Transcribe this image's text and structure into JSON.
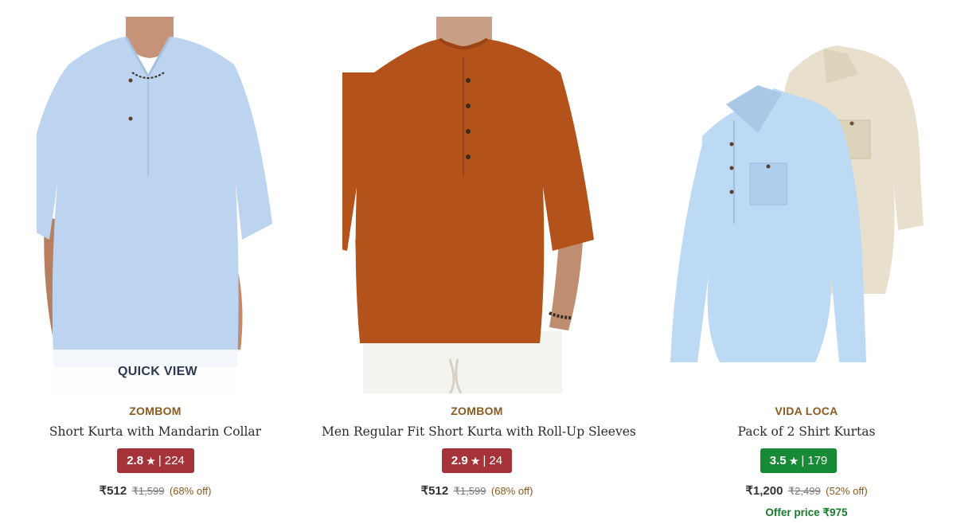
{
  "products": [
    {
      "brand": "ZOMBOM",
      "name": "Short Kurta with Mandarin Collar",
      "rating": "2.8",
      "rating_count": "224",
      "price": "₹512",
      "mrp": "₹1,599",
      "discount": "(68% off)",
      "rating_color": "#a7333a",
      "image": "light-blue-kurta",
      "quick_view": "QUICK VIEW"
    },
    {
      "brand": "ZOMBOM",
      "name": "Men Regular Fit Short Kurta with Roll-Up Sleeves",
      "rating": "2.9",
      "rating_count": "24",
      "price": "₹512",
      "mrp": "₹1,599",
      "discount": "(68% off)",
      "rating_color": "#a7333a",
      "image": "rust-orange-kurta"
    },
    {
      "brand": "VIDA LOCA",
      "name": "Pack of 2 Shirt Kurtas",
      "rating": "3.5",
      "rating_count": "179",
      "price": "₹1,200",
      "mrp": "₹2,499",
      "discount": "(52% off)",
      "offer": "Offer price ₹975",
      "rating_color": "#168a35",
      "image": "blue-and-beige-shirt-kurtas"
    }
  ],
  "icons": {
    "star": "★"
  }
}
